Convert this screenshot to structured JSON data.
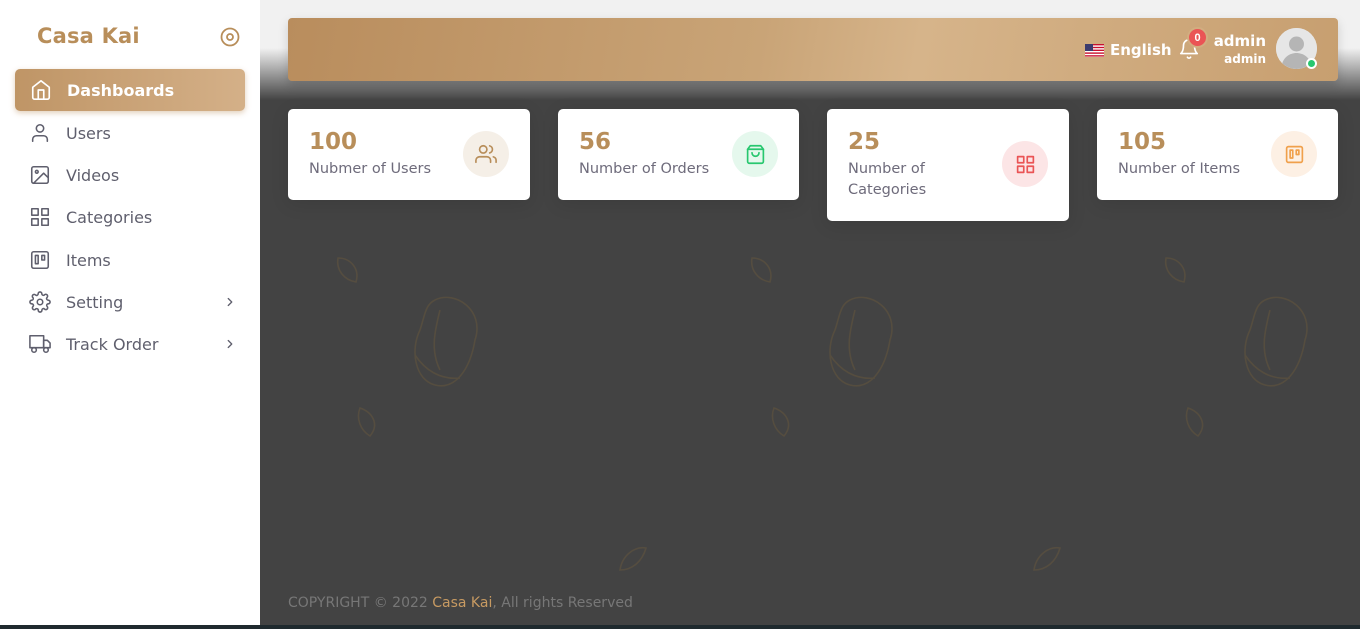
{
  "app": {
    "brand": "Casa Kai"
  },
  "sidebar": {
    "items": [
      {
        "label": "Dashboards",
        "icon": "home-icon",
        "active": true
      },
      {
        "label": "Users",
        "icon": "user-icon"
      },
      {
        "label": "Videos",
        "icon": "image-icon"
      },
      {
        "label": "Categories",
        "icon": "grid-icon"
      },
      {
        "label": "Items",
        "icon": "trello-icon"
      },
      {
        "label": "Setting",
        "icon": "gear-icon",
        "has_submenu": true
      },
      {
        "label": "Track Order",
        "icon": "truck-icon",
        "has_submenu": true
      }
    ]
  },
  "navbar": {
    "language": "English",
    "language_flag": "us-flag-icon",
    "notification_count": "0",
    "user_name": "admin",
    "user_role": "admin"
  },
  "stats": [
    {
      "value": "100",
      "caption": "Nubmer of Users",
      "icon": "users-icon",
      "accent": "#b88e5a",
      "bg": "#f5efe7"
    },
    {
      "value": "56",
      "caption": "Number of Orders",
      "icon": "shopping-bag-icon",
      "accent": "#28c76f",
      "bg": "#e5f8ed"
    },
    {
      "value": "25",
      "caption": "Number of Categories",
      "icon": "grid-icon",
      "accent": "#ea5455",
      "bg": "#fce5e6"
    },
    {
      "value": "105",
      "caption": "Number of Items",
      "icon": "trello-icon",
      "accent": "#f0a04b",
      "bg": "#fdf0e4"
    }
  ],
  "footer": {
    "prefix": "COPYRIGHT © 2022 ",
    "link": "Casa Kai",
    "suffix": ", All rights Reserved"
  },
  "colors": {
    "accent": "#b88e5a",
    "background": "#434343"
  }
}
